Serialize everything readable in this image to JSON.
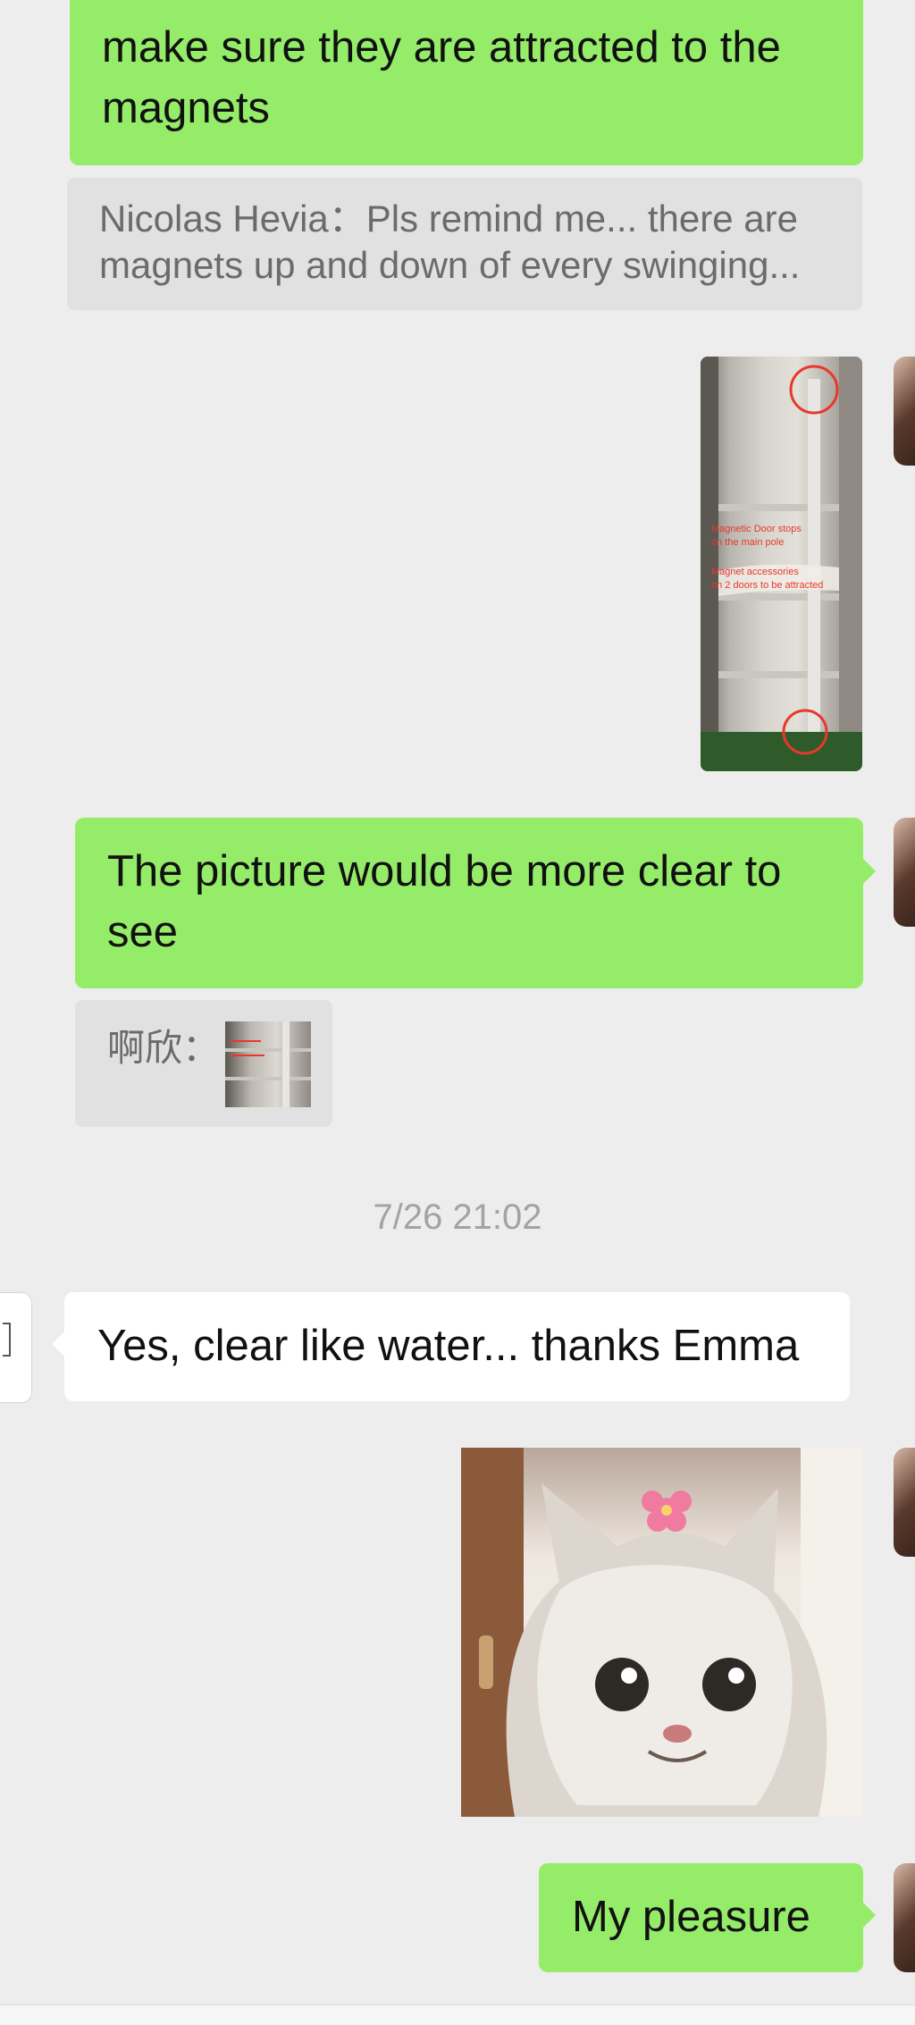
{
  "messages": {
    "m1_line1": "make sure they are attracted to the",
    "m1_line2": "magnets",
    "q1_line1": "Nicolas Hevia：Pls remind me... there are",
    "q1_line2": "magnets up and down of every swinging...",
    "image1": {
      "text_line1": "Magnetic Door stops",
      "text_line2": "on the main pole",
      "text_line3": "Magnet accessories",
      "text_line4": "on 2 doors to be attracted"
    },
    "m2_line1": "The picture would be more clear to",
    "m2_line2": "see",
    "q2_sender": "啊欣：",
    "timestamp": "7/26 21:02",
    "m3": "Yes, clear like water... thanks Emma",
    "m4": "My pleasure"
  },
  "colors": {
    "background": "#ededed",
    "bubble_outgoing": "#95ec69",
    "bubble_incoming": "#ffffff",
    "quote_bg": "#e1e1e1",
    "annotation_red": "#e8382b"
  },
  "icons": {
    "left_avatar": "document-icon",
    "right_avatar": "user-avatar-photo"
  }
}
